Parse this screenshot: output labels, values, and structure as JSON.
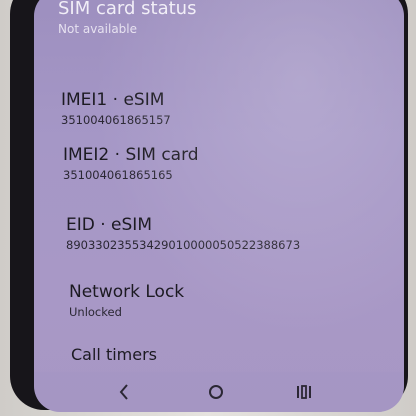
{
  "settings": {
    "sim_status": {
      "title": "SIM card status",
      "value": "Not available"
    },
    "imei1": {
      "title": "IMEI1 · eSIM",
      "value": "351004061865157"
    },
    "imei2": {
      "title": "IMEI2 · SIM card",
      "value": "351004061865165"
    },
    "eid": {
      "title": "EID · eSIM",
      "value": "89033023553429010000050522388673"
    },
    "network_lock": {
      "title": "Network Lock",
      "value": "Unlocked"
    },
    "call_timers": {
      "title": "Call timers"
    }
  },
  "nav": {
    "back_icon": "back-chevron",
    "home_icon": "home-circle",
    "recents_icon": "recents-bars"
  },
  "colors": {
    "screen_bg": "#a597c6",
    "text_primary": "#1c1a22"
  }
}
